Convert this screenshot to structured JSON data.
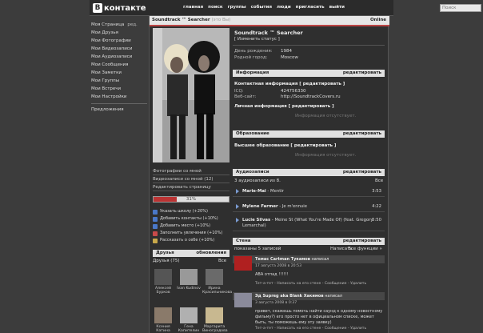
{
  "topbar": {
    "logo_letter": "В",
    "logo_text": "контакте",
    "nav": [
      "главная",
      "поиск",
      "группы",
      "события",
      "люди",
      "пригласить",
      "выйти"
    ],
    "search_placeholder": "Поиск"
  },
  "leftmenu": {
    "items": [
      "Моя Страница",
      "Мои Друзья",
      "Мои Фотографии",
      "Мои Видеозаписи",
      "Мои Аудиозаписи",
      "Мои Сообщения",
      "Мои Заметки",
      "Мои Группы",
      "Мои Встречи",
      "Мои Настройки"
    ],
    "edit_label": "ред.",
    "extra": "Предложения"
  },
  "profile": {
    "header_name": "Soundtrack ™ Searcher",
    "header_sub": "(это Вы)",
    "online": "Online",
    "name": "Soundtrack ™ Searcher",
    "change_status": "[ Изменить статус ]",
    "birthday_label": "День рождения:",
    "birthday_value": "1984",
    "city_label": "Родной город:",
    "city_value": "Moscow"
  },
  "left_links": [
    "Фотографии со мной",
    "Видеозаписи со мной (12)",
    "Редактировать страницу"
  ],
  "progress": {
    "percent": 31,
    "label": "31%"
  },
  "suggestions": [
    {
      "text": "Указать школу (+20%)",
      "color": "#4a78c8"
    },
    {
      "text": "Добавить контакты (+10%)",
      "color": "#4a78c8"
    },
    {
      "text": "Добавить место (+10%)",
      "color": "#4a78c8"
    },
    {
      "text": "Заполнить увлечения (+10%)",
      "color": "#c84a4a"
    },
    {
      "text": "Рассказать о себе (+10%)",
      "color": "#c8a84a"
    }
  ],
  "friends": {
    "title": "Друзья",
    "updates": "обновления",
    "count": "Друзья (75)",
    "all": "Все",
    "list": [
      {
        "name": "Алексей Бурков"
      },
      {
        "name": "Ivan Kudinov"
      },
      {
        "name": "Ирина Красильникова"
      },
      {
        "name": "Ксения Катина"
      },
      {
        "name": "Гена Капителин"
      },
      {
        "name": "Маргарита Виноградова"
      }
    ]
  },
  "info": {
    "title": "Информация",
    "edit": "редактировать",
    "contacts_title": "Контактная информация",
    "contacts_edit": "[ редактировать ]",
    "icq_label": "ICQ:",
    "icq_value": "424756330",
    "site_label": "Веб-сайт:",
    "site_value": "http://SoundtrackCovers.ru",
    "personal_title": "Личная информация",
    "personal_edit": "[ редактировать ]",
    "missing": "Информация отсутствует."
  },
  "education": {
    "title": "Образование",
    "edit": "редактировать",
    "higher": "Высшее образование",
    "higher_edit": "[ редактировать ]",
    "missing": "Информация отсутствует."
  },
  "audio": {
    "title": "Аудиозаписи",
    "edit": "редактировать",
    "count": "3 аудиозаписи из 8.",
    "all": "Все",
    "tracks": [
      {
        "artist": "Marie-Mai",
        "title": "Mentir",
        "dur": "3:53"
      },
      {
        "artist": "Mylene Farmer",
        "title": "Je m'ennuie",
        "dur": "4:22"
      },
      {
        "artist": "Lucie Silvas",
        "title": "Meine St (What You're Made Of) (feat. Gregory Lemarchal)",
        "dur": "5:50"
      }
    ]
  },
  "wall": {
    "title": "Стена",
    "edit": "редактировать",
    "shown": "показаны 5 записей",
    "write": "Написать",
    "all": "Все функции »",
    "posts": [
      {
        "author": "Темас Cartman Тукамов",
        "wrote": "написал",
        "date": "17 августа 2008 в 20:53",
        "text": "АВА отпад !!!!!!",
        "actions": "Тет-а-тет - Написать на его стене - Сообщение - Удалить"
      },
      {
        "author": "Эд Supreg aka Blank Хакимов",
        "wrote": "написал",
        "date": "3 августа 2008 в 0:37",
        "text": "привет, скажешь помочь найти саунд к одному новостному фильму?) его просто нет в официальном списке, может быть, ты поможешь ему эту заявку)",
        "actions": "Тет-а-тет - Написать на его стене - Сообщение - Удалить"
      }
    ]
  }
}
